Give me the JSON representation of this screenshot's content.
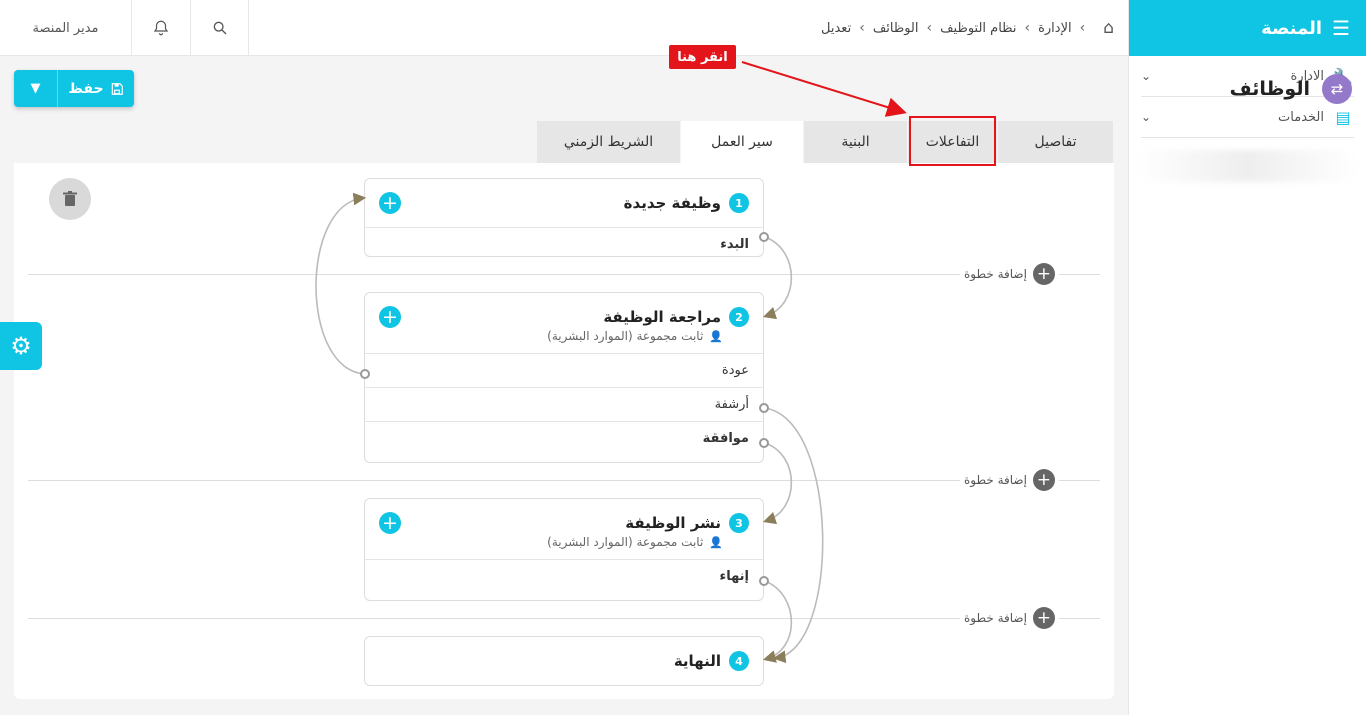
{
  "sidebar": {
    "brand": "المنصة",
    "items": [
      {
        "label": "الادارة",
        "icon": "wrench-icon"
      },
      {
        "label": "الخدمات",
        "icon": "server-icon"
      }
    ]
  },
  "topbar": {
    "user_label": "مدير المنصة",
    "breadcrumb": [
      "الإدارة",
      "نظام التوظيف",
      "الوظائف",
      "تعديل"
    ]
  },
  "page": {
    "title": "الوظائف",
    "save_label": "حفظ"
  },
  "tabs": [
    "تفاصيل",
    "التفاعلات",
    "البنية",
    "سير العمل",
    "الشريط الزمني"
  ],
  "active_tab": "سير العمل",
  "annotation": {
    "label": "انقر هنا"
  },
  "add_step_label": "إضافة خطوة",
  "steps": [
    {
      "number": "1",
      "title": "وظيفة جديدة",
      "subtitle": "",
      "actions": [
        {
          "label": "البدء",
          "bold": true
        }
      ]
    },
    {
      "number": "2",
      "title": "مراجعة الوظيفة",
      "subtitle": "ثابت مجموعة (الموارد البشرية)",
      "actions": [
        {
          "label": "عودة",
          "bold": false
        },
        {
          "label": "أرشفة",
          "bold": false
        },
        {
          "label": "موافقة",
          "bold": true
        }
      ]
    },
    {
      "number": "3",
      "title": "نشر الوظيفة",
      "subtitle": "ثابت مجموعة (الموارد البشرية)",
      "actions": [
        {
          "label": "إنهاء",
          "bold": true
        }
      ]
    },
    {
      "number": "4",
      "title": "النهاية",
      "subtitle": "",
      "actions": []
    }
  ],
  "colors": {
    "accent": "#10c4e3",
    "annotation": "#e3151a",
    "title_icon": "#9478c9"
  }
}
